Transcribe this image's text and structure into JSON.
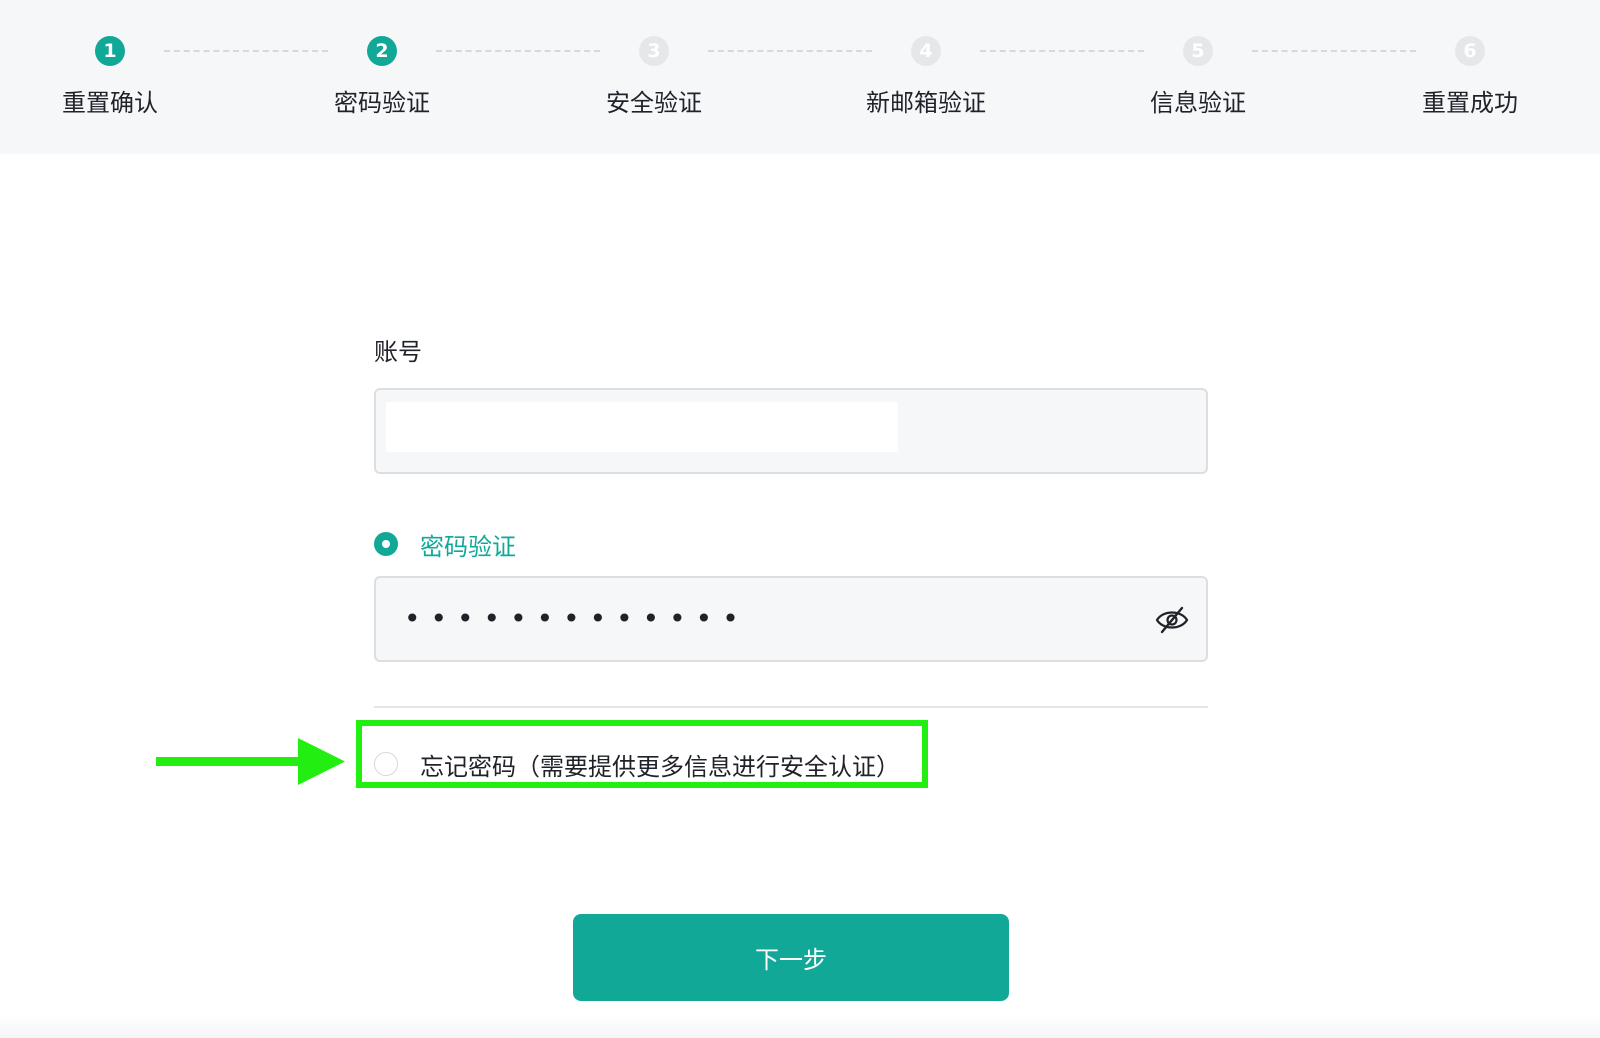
{
  "stepper": {
    "steps": [
      {
        "number": "1",
        "label": "重置确认",
        "state": "done"
      },
      {
        "number": "2",
        "label": "密码验证",
        "state": "active"
      },
      {
        "number": "3",
        "label": "安全验证",
        "state": "pending"
      },
      {
        "number": "4",
        "label": "新邮箱验证",
        "state": "pending"
      },
      {
        "number": "5",
        "label": "信息验证",
        "state": "pending"
      },
      {
        "number": "6",
        "label": "重置成功",
        "state": "pending"
      }
    ],
    "active_color": "#12a898",
    "inactive_color": "#e6e7ea"
  },
  "form": {
    "account_label": "账号",
    "account_value": "",
    "password_option_label": "密码验证",
    "password_option_selected": true,
    "password_masked": "•••••••••••••",
    "password_visibility_icon": "eye-slash-icon",
    "forgot_option_label": "忘记密码（需要提供更多信息进行安全认证）",
    "forgot_option_selected": false
  },
  "actions": {
    "next_label": "下一步"
  },
  "annotation": {
    "highlight_color": "#22ee11",
    "arrow_icon": "right-arrow-icon"
  }
}
